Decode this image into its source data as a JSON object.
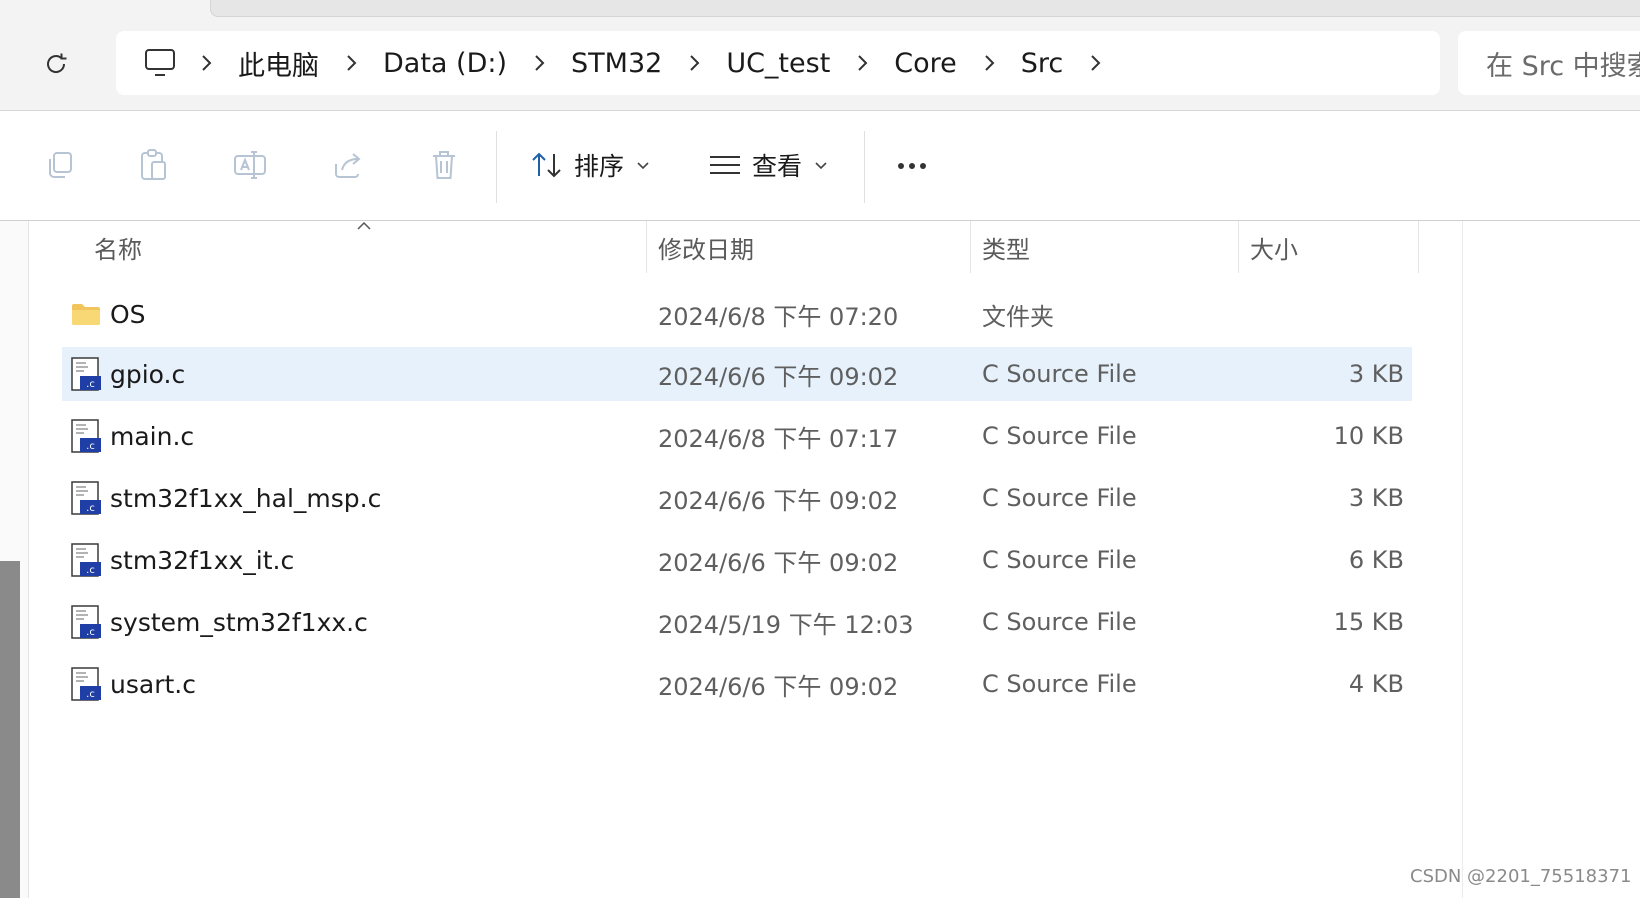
{
  "breadcrumb": [
    "此电脑",
    "Data (D:)",
    "STM32",
    "UC_test",
    "Core",
    "Src"
  ],
  "search": {
    "placeholder": "在 Src 中搜索"
  },
  "toolbar": {
    "sort_label": "排序",
    "view_label": "查看"
  },
  "columns": {
    "name": "名称",
    "date": "修改日期",
    "type": "类型",
    "size": "大小"
  },
  "files": [
    {
      "name": "OS",
      "date": "2024/6/8 下午 07:20",
      "type": "文件夹",
      "size": "",
      "icon": "folder-icon"
    },
    {
      "name": "gpio.c",
      "date": "2024/6/6 下午 09:02",
      "type": "C Source File",
      "size": "3 KB",
      "icon": "c-file-icon",
      "selected": true
    },
    {
      "name": "main.c",
      "date": "2024/6/8 下午 07:17",
      "type": "C Source File",
      "size": "10 KB",
      "icon": "c-file-icon"
    },
    {
      "name": "stm32f1xx_hal_msp.c",
      "date": "2024/6/6 下午 09:02",
      "type": "C Source File",
      "size": "3 KB",
      "icon": "c-file-icon"
    },
    {
      "name": "stm32f1xx_it.c",
      "date": "2024/6/6 下午 09:02",
      "type": "C Source File",
      "size": "6 KB",
      "icon": "c-file-icon"
    },
    {
      "name": "system_stm32f1xx.c",
      "date": "2024/5/19 下午 12:03",
      "type": "C Source File",
      "size": "15 KB",
      "icon": "c-file-icon"
    },
    {
      "name": "usart.c",
      "date": "2024/6/6 下午 09:02",
      "type": "C Source File",
      "size": "4 KB",
      "icon": "c-file-icon"
    }
  ],
  "watermark": "CSDN @2201_75518371",
  "colors": {
    "selection": "#e6f1fb",
    "folder": "#f2c55c",
    "c_file_badge": "#1f3fa6"
  }
}
